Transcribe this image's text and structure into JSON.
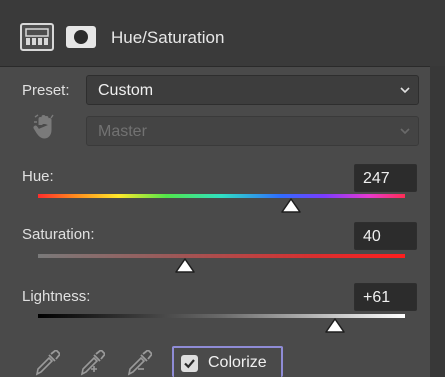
{
  "header": {
    "title": "Hue/Saturation",
    "icons": [
      "adjustment-layer-icon",
      "layer-mask-icon"
    ]
  },
  "preset": {
    "label": "Preset:",
    "value": "Custom"
  },
  "channel": {
    "value": "Master",
    "enabled": false,
    "icon": "targeted-adjustment-hand-icon"
  },
  "hue": {
    "label": "Hue:",
    "value": "247",
    "level": 0.69
  },
  "saturation": {
    "label": "Saturation:",
    "value": "40",
    "level": 0.4
  },
  "lightness": {
    "label": "Lightness:",
    "value": "+61",
    "level": 0.81
  },
  "colorize": {
    "label": "Colorize",
    "checked": true
  },
  "tools": [
    "eyedropper-icon",
    "eyedropper-plus-icon",
    "eyedropper-minus-icon"
  ],
  "colors": {
    "background": "#4a4a4a",
    "header": "#3a3a3a",
    "colorize_border": "#8f8cd6"
  }
}
